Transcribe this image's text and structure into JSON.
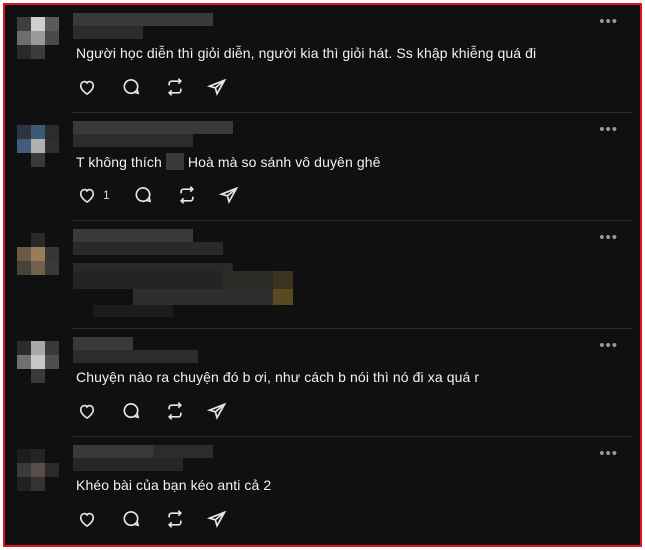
{
  "colors": {
    "background": "#101010",
    "text": "#f2f2f2",
    "icon": "#e6e6e6",
    "border": "#e0121b",
    "divider": "#2c2c2c"
  },
  "icons": [
    "heart-icon",
    "comment-icon",
    "repost-icon",
    "share-icon",
    "more-icon"
  ],
  "more_label": "•••",
  "posts": [
    {
      "comment": "Người học diễn thì giỏi diễn, người kia thì giỏi hát. Ss khập khiễng quá đi",
      "likes": ""
    },
    {
      "comment_before": "T không thích",
      "comment_after": "Hoà mà so sánh vô duyên ghê",
      "likes": "1"
    },
    {
      "comment": "",
      "likes": ""
    },
    {
      "comment": "Chuyện nào ra chuyện đó b ơi, như cách b nói thì nó đi xa quá r",
      "likes": ""
    },
    {
      "comment": "Khéo bài của bạn kéo anti cả 2",
      "likes": ""
    }
  ]
}
